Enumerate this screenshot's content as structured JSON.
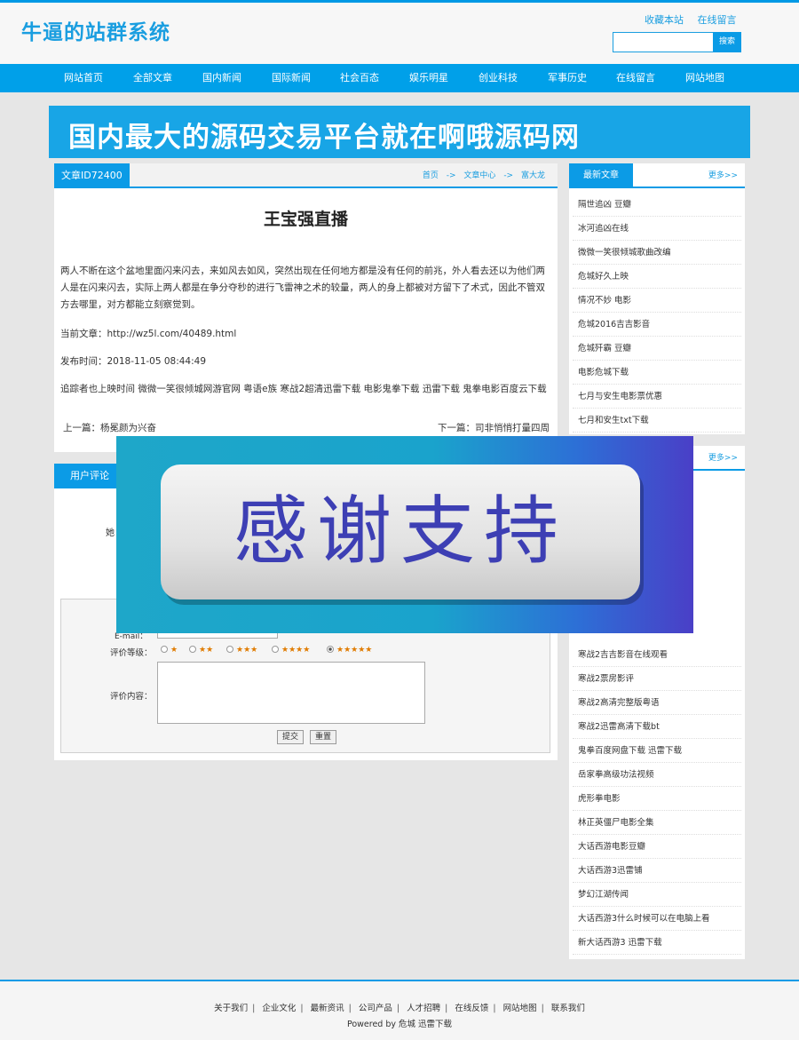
{
  "site": {
    "title": "牛逼的站群系统",
    "top_links": [
      "收藏本站",
      "在线留言"
    ],
    "search_button": "搜索"
  },
  "nav": [
    "网站首页",
    "全部文章",
    "国内新闻",
    "国际新闻",
    "社会百态",
    "娱乐明星",
    "创业科技",
    "军事历史",
    "在线留言",
    "网站地图"
  ],
  "banner": {
    "text": "国内最大的源码交易平台就在啊哦源码网"
  },
  "article": {
    "tab": "文章ID72400",
    "breadcrumb": [
      "首页",
      "->",
      "文章中心",
      "->",
      "富大龙"
    ],
    "title": "王宝强直播",
    "body": "两人不断在这个盆地里面闪来闪去，来如风去如风，突然出现在任何地方都是没有任何的前兆，外人看去还以为他们两人是在闪来闪去，实际上两人都是在争分夺秒的进行飞雷神之术的较量，两人的身上都被对方留下了术式，因此不管双方去哪里，对方都能立刻察觉到。",
    "current": "当前文章：http://wz5l.com/40489.html",
    "time": "发布时间：2018-11-05 08:44:49",
    "tags": "追踪者也上映时间 微微一笑很倾城网游官网 粤语e族 寒战2超清迅雷下载 电影鬼拳下载 迅雷下载 鬼拳电影百度云下载",
    "prev": "上一篇：杨冕颜为兴奋",
    "next": "下一篇：司非悄悄打量四周"
  },
  "comments": {
    "tab": "用户评论",
    "nick_label": "她",
    "email_label": "E-mail：",
    "rating_label": "评价等级：",
    "ratings": [
      "★",
      "★★",
      "★★★",
      "★★★★",
      "★★★★★"
    ],
    "rating_selected_index": 4,
    "content_label": "评价内容：",
    "submit": "提交",
    "reset": "重置"
  },
  "sidebar1": {
    "tab": "最新文章",
    "more": "更多>>",
    "items": [
      "隔世追凶 豆瓣",
      "冰河追凶在线",
      "微微一笑很倾城歌曲改编",
      "危城好久上映",
      "情况不妙 电影",
      "危城2016吉吉影音",
      "危城歼霸 豆瓣",
      "电影危城下载",
      "七月与安生电影票优惠",
      "七月和安生txt下载"
    ]
  },
  "sidebar2": {
    "more": "更多>>",
    "items": [
      "寒战2吉吉影音在线观看",
      "寒战2票房影评",
      "寒战2高清完整版粤语",
      "寒战2迅雷高清下载bt",
      "鬼拳百度网盘下载 迅雷下载",
      "岳家拳高级功法视频",
      "虎形拳电影",
      "林正英僵尸电影全集",
      "大话西游电影豆瓣",
      "大话西游3迅雷铺",
      "梦幻江湖传闻",
      "大话西游3什么时候可以在电脑上看",
      "新大话西游3 迅雷下载"
    ]
  },
  "overlay": {
    "text": "感谢支持"
  },
  "footer": {
    "links": [
      "关于我们",
      "企业文化",
      "最新资讯",
      "公司产品",
      "人才招聘",
      "在线反馈",
      "网站地图",
      "联系我们"
    ],
    "powered": "Powered by 危城 迅雷下载"
  }
}
